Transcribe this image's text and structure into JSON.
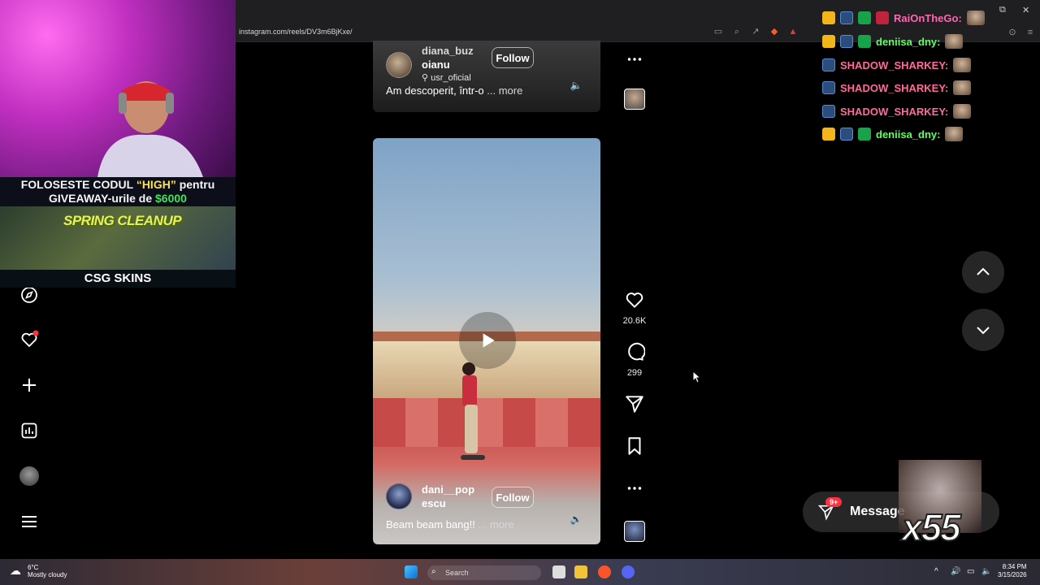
{
  "browser": {
    "url": "instagram.com/reels/DV3m6BjKxe/"
  },
  "reels": {
    "top": {
      "username": "diana_buzoianu",
      "username_line1": "diana_buz",
      "username_line2": "oianu",
      "audio": "usr_oficial",
      "follow_label": "Follow",
      "caption": "Am descoperit, într-o",
      "more": "... more"
    },
    "main": {
      "username_line1": "dani__pop",
      "username_line2": "escu",
      "follow_label": "Follow",
      "caption": "Beam beam bang!!",
      "more": "... more",
      "likes": "20.6K",
      "comments": "299"
    }
  },
  "messages": {
    "label": "Message",
    "badge": "9+"
  },
  "overlay": {
    "promo_pre": "FOLOSESTE CODUL ",
    "promo_code": "“HIGH”",
    "promo_mid": " pentru",
    "promo_line2_pre": "GIVEAWAY-urile de ",
    "promo_amount": "$6000",
    "banner_title": "SPRING CLEANUP",
    "brand": "CSG SKINS",
    "multiplier": "x55"
  },
  "chat": [
    {
      "name": "RaiOnTheGo:",
      "color": "#ff66b3"
    },
    {
      "name": "deniisa_dny:",
      "color": "#5dff5d"
    },
    {
      "name": "SHADOW_SHARKEY:",
      "color": "#ff6b9a"
    },
    {
      "name": "SHADOW_SHARKEY:",
      "color": "#ff6b9a"
    },
    {
      "name": "SHADOW_SHARKEY:",
      "color": "#ff6b9a"
    },
    {
      "name": "deniisa_dny:",
      "color": "#5dff5d"
    }
  ],
  "taskbar": {
    "temp": "6°C",
    "weather": "Mostly cloudy",
    "search": "Search",
    "time": "8:34 PM",
    "date": "3/15/2026"
  }
}
